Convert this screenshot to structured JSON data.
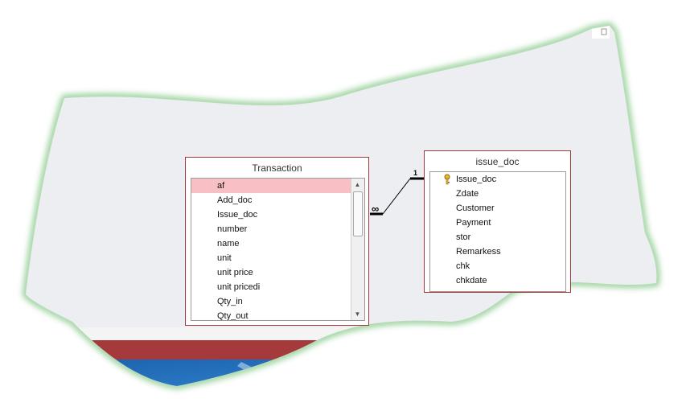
{
  "tables": {
    "transaction": {
      "title": "Transaction",
      "fields": [
        "af",
        "Add_doc",
        "Issue_doc",
        "number",
        "name",
        "unit",
        "unit price",
        "unit pricedi",
        "Qty_in",
        "Qty_out"
      ],
      "selected_field": "af"
    },
    "issue_doc": {
      "title": "issue_doc",
      "fields": [
        "Issue_doc",
        "Zdate",
        "Customer",
        "Payment",
        "stor",
        "Remarkess",
        "chk",
        "chkdate"
      ],
      "primary_key": "Issue_doc"
    }
  },
  "relationship": {
    "one_side_label": "1",
    "many_side_label": "∞"
  },
  "colors": {
    "canvas": "#eceef2",
    "table_border": "#a03a3a",
    "selected_row": "#f8c0c4",
    "glow": "#79c27b",
    "status_bar": "#a43a3c",
    "taskbar": "#1e6cb8"
  }
}
